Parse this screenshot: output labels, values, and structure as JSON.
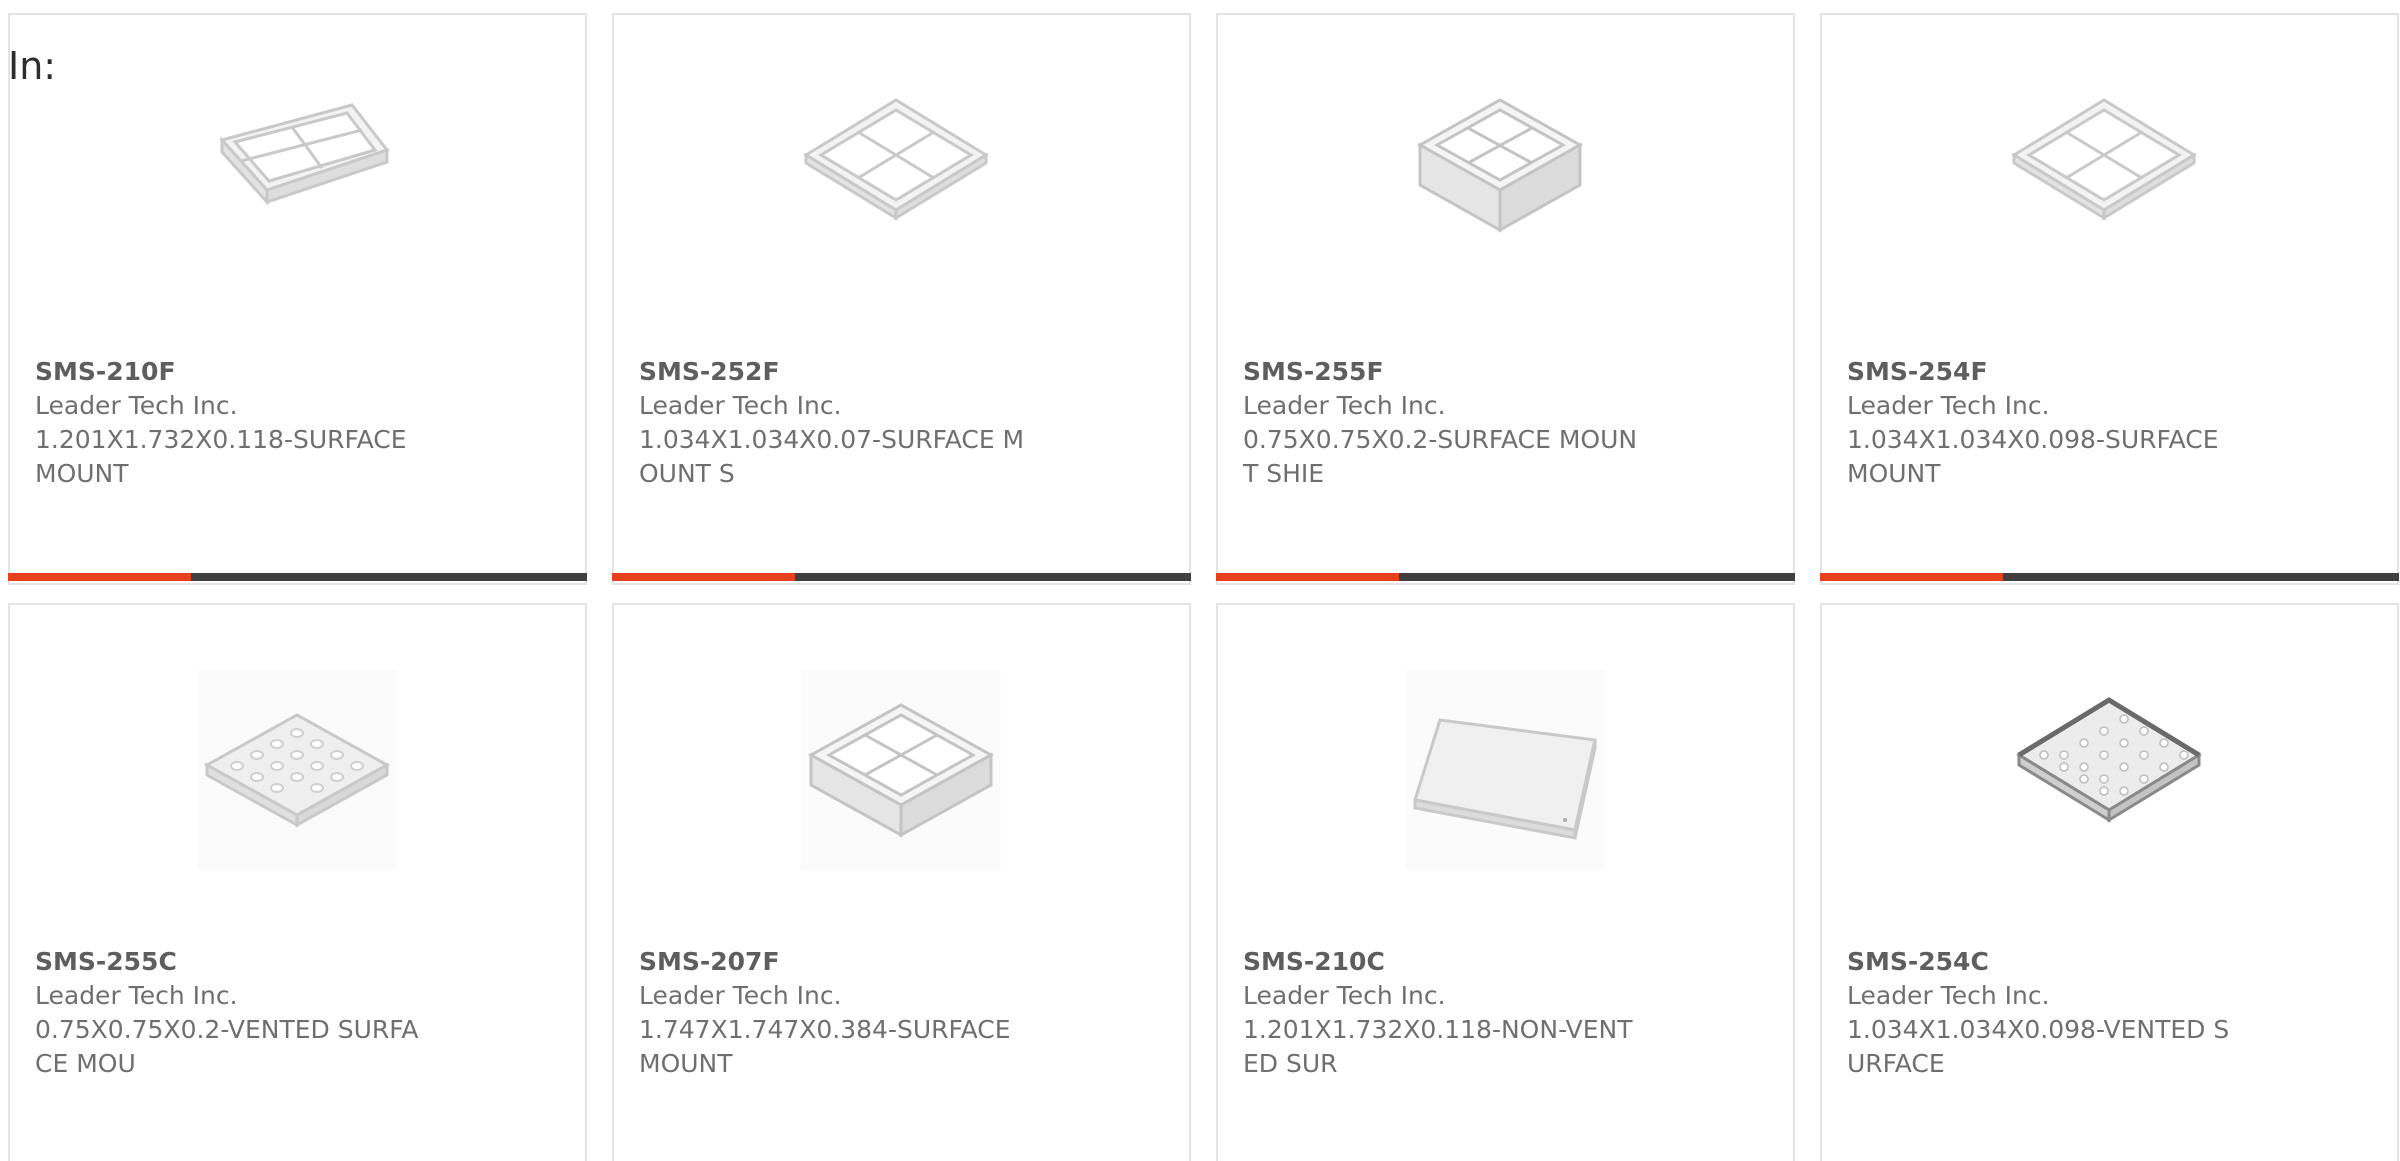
{
  "filter_label": "In:",
  "accent_color": "#e8401c",
  "bar_color": "#404040",
  "products": [
    {
      "part_number": "SMS-210F",
      "manufacturer": "Leader Tech Inc.",
      "description": "1.201X1.732X0.118-SURFACE MOUNT",
      "icon": "shield-frame-rect-icon"
    },
    {
      "part_number": "SMS-252F",
      "manufacturer": "Leader Tech Inc.",
      "description": "1.034X1.034X0.07-SURFACE MOUNT S",
      "icon": "shield-frame-square-icon"
    },
    {
      "part_number": "SMS-255F",
      "manufacturer": "Leader Tech Inc.",
      "description": "0.75X0.75X0.2-SURFACE MOUNT SHIE",
      "icon": "shield-frame-tall-icon"
    },
    {
      "part_number": "SMS-254F",
      "manufacturer": "Leader Tech Inc.",
      "description": "1.034X1.034X0.098-SURFACE MOUNT",
      "icon": "shield-frame-square-icon"
    },
    {
      "part_number": "SMS-255C",
      "manufacturer": "Leader Tech Inc.",
      "description": "0.75X0.75X0.2-VENTED SURFACE MOU",
      "icon": "shield-cover-vented-icon"
    },
    {
      "part_number": "SMS-207F",
      "manufacturer": "Leader Tech Inc.",
      "description": "1.747X1.747X0.384-SURFACE MOUNT",
      "icon": "shield-frame-tall-icon"
    },
    {
      "part_number": "SMS-210C",
      "manufacturer": "Leader Tech Inc.",
      "description": "1.201X1.732X0.118-NON-VENTED SUR",
      "icon": "shield-cover-solid-icon"
    },
    {
      "part_number": "SMS-254C",
      "manufacturer": "Leader Tech Inc.",
      "description": "1.034X1.034X0.098-VENTED SURFACE",
      "icon": "shield-cover-mesh-icon"
    }
  ]
}
